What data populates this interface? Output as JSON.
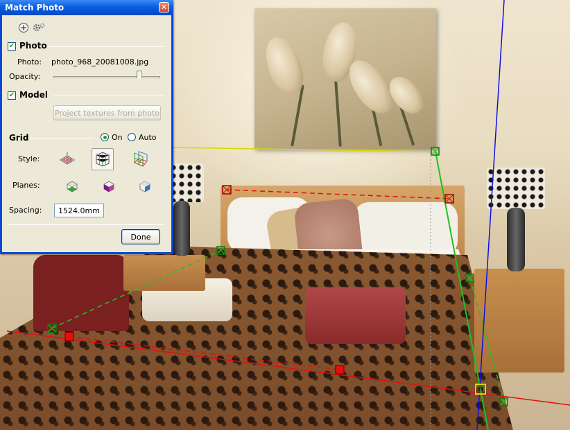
{
  "dialog": {
    "title": "Match Photo",
    "close_glyph": "✕",
    "tools": [
      {
        "icon": "add-photo-icon"
      },
      {
        "icon": "gear-icon"
      }
    ],
    "photo": {
      "section_label": "Photo",
      "checked": true,
      "file_label": "Photo:",
      "file_name": "photo_968_20081008.jpg",
      "opacity_label": "Opacity:",
      "opacity_level": 0.82
    },
    "model": {
      "section_label": "Model",
      "checked": true,
      "project_button": "Project textures from photo"
    },
    "grid": {
      "section_label": "Grid",
      "on_label": "On",
      "auto_label": "Auto",
      "selected_mode": "On",
      "style_label": "Style:",
      "styles": [
        {
          "icon": "grid-style-1-icon",
          "selected": false
        },
        {
          "icon": "grid-style-2-icon",
          "selected": true
        },
        {
          "icon": "grid-style-3-icon",
          "selected": false
        }
      ],
      "planes_label": "Planes:",
      "planes": [
        {
          "icon": "plane-xy-icon"
        },
        {
          "icon": "plane-xz-icon"
        },
        {
          "icon": "plane-yz-icon"
        }
      ],
      "spacing_label": "Spacing:",
      "spacing_value": "1524.0mm"
    },
    "done_button": "Done"
  },
  "colors": {
    "axis_red": "#e01010",
    "axis_green": "#20c020",
    "axis_blue": "#1010e0",
    "horizon_yellow": "#d8d800",
    "titlebar_blue": "#0a5fe0",
    "dialog_bg": "#ece9d8"
  }
}
